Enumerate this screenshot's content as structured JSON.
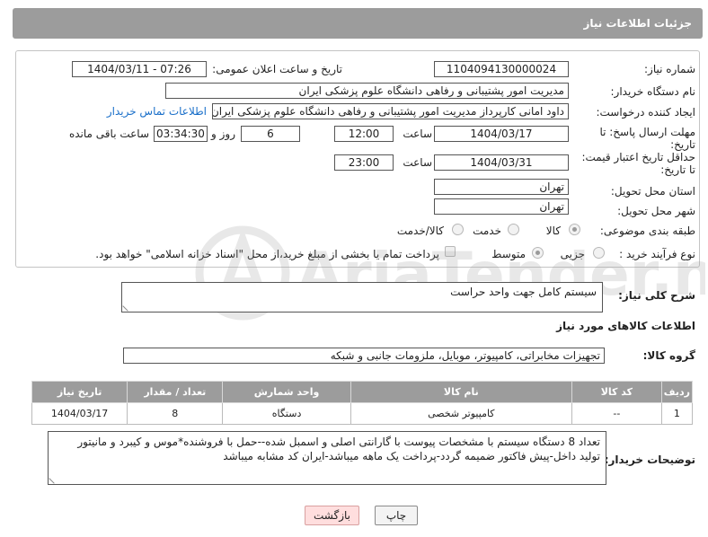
{
  "header": {
    "title": "جزئیات اطلاعات نیاز"
  },
  "form": {
    "need_number_label": "شماره نیاز:",
    "need_number": "1104094130000024",
    "announce_label": "تاریخ و ساعت اعلان عمومی:",
    "announce_value": "1404/03/11 - 07:26",
    "buyer_org_label": "نام دستگاه خریدار:",
    "buyer_org": "مدیریت امور پشتیبانی و رفاهی دانشگاه علوم پزشکی ایران",
    "creator_label": "ایجاد کننده درخواست:",
    "creator": "داود امانی کارپرداز مدیریت امور پشتیبانی و رفاهی دانشگاه علوم پزشکی ایران",
    "contact_link": "اطلاعات تماس خریدار",
    "reply_deadline_label_1": "مهلت ارسال پاسخ: تا",
    "reply_deadline_label_2": "تاریخ:",
    "reply_date": "1404/03/17",
    "time_label": "ساعت",
    "reply_time": "12:00",
    "days_value": "6",
    "days_label": "روز و",
    "remaining_value": "03:34:30",
    "remaining_label": "ساعت باقی مانده",
    "validity_label_1": "حداقل تاریخ اعتبار قیمت:",
    "validity_label_2": "تا تاریخ:",
    "validity_date": "1404/03/31",
    "validity_time": "23:00",
    "province_label": "استان محل تحویل:",
    "province": "تهران",
    "city_label": "شهر محل تحویل:",
    "city": "تهران",
    "category_label": "طبقه بندی موضوعی:",
    "category_options": [
      "کالا",
      "خدمت",
      "کالا/خدمت"
    ],
    "category_selected": "کالا",
    "process_label": "نوع فرآیند خرید :",
    "process_options": [
      "جزیی",
      "متوسط"
    ],
    "process_selected": "متوسط",
    "payment_note": "پرداخت تمام یا بخشی از مبلغ خرید،از محل \"اسناد خزانه اسلامی\" خواهد بود."
  },
  "description": {
    "label": "شرح کلی نیاز:",
    "value": "سیستم کامل جهت واحد حراست"
  },
  "goods": {
    "section_title": "اطلاعات کالاهای مورد نیاز",
    "group_label": "گروه کالا:",
    "group_value": "تجهیزات مخابراتی، کامپیوتر، موبایل، ملزومات جانبی و شبکه",
    "columns": [
      "ردیف",
      "کد کالا",
      "نام کالا",
      "واحد شمارش",
      "تعداد / مقدار",
      "تاریخ نیاز"
    ],
    "rows": [
      [
        "1",
        "--",
        "کامپیوتر شخصی",
        "دستگاه",
        "8",
        "1404/03/17"
      ]
    ]
  },
  "buyer_notes": {
    "label": "توضیحات خریدار:",
    "value": "تعداد 8 دستگاه سیستم با مشخصات پیوست با گارانتی اصلی و اسمبل شده--حمل با فروشنده*موس و کیبرد و مانیتور تولید داخل-پیش فاکتور ضمیمه گردد-پرداخت یک ماهه میباشد-ایران کد مشابه میباشد"
  },
  "buttons": {
    "print": "چاپ",
    "back": "بازگشت"
  },
  "watermark": {
    "text": "AriaTender.neT"
  },
  "colors": {
    "header_bg": "#9c9c9c",
    "link": "#1a6fc9",
    "back_button": "#ffdede"
  }
}
